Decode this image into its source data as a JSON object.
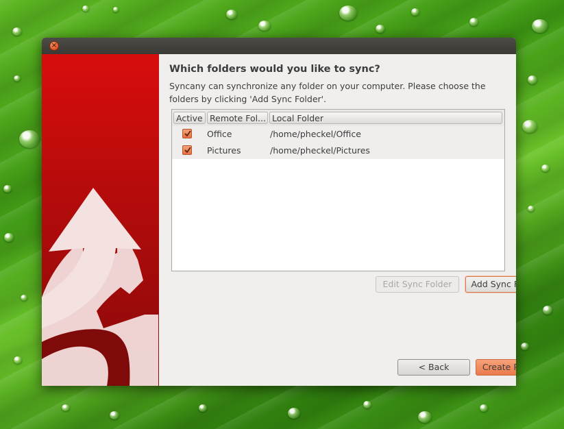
{
  "window": {
    "close_glyph": "×"
  },
  "wizard": {
    "heading": "Which folders would you like to sync?",
    "description": "Syncany can synchronize any folder on your computer. Please choose the folders by clicking 'Add Sync Folder'."
  },
  "table": {
    "columns": [
      "Active",
      "Remote Fol...",
      "Local Folder"
    ],
    "rows": [
      {
        "active": true,
        "remote": "Office",
        "local": "/home/pheckel/Office"
      },
      {
        "active": true,
        "remote": "Pictures",
        "local": "/home/pheckel/Pictures"
      }
    ]
  },
  "buttons": {
    "edit_sync_folder": "Edit Sync Folder",
    "add_sync_folder": "Add Sync Folder",
    "back": "< Back",
    "create_profile": "Create Profile"
  },
  "colors": {
    "accent": "#ea7a4a",
    "side_panel_top": "#d80d0d",
    "side_panel_bottom": "#8a0a0a"
  },
  "icons": {
    "side_panel": "syncany-arrows-logo",
    "close": "close-icon",
    "checkbox": "checkmark-icon"
  }
}
